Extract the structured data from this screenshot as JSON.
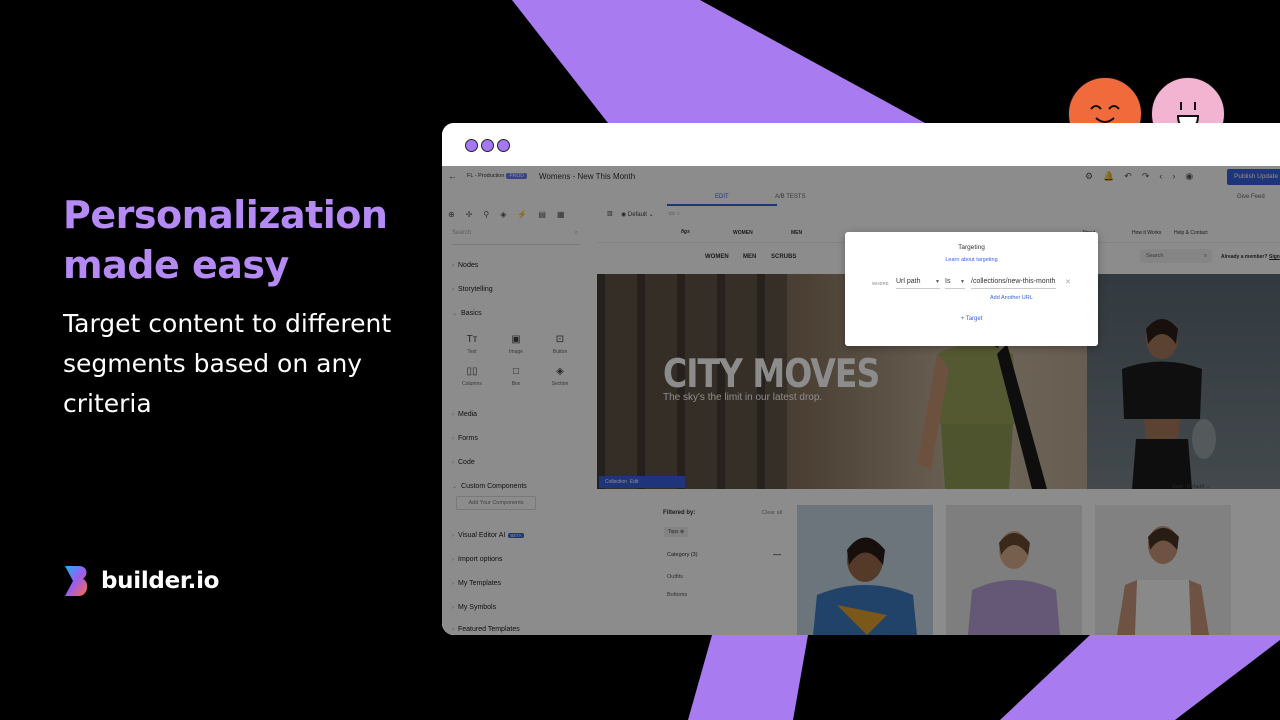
{
  "headline": {
    "title": "Personalization made easy",
    "subtitle": "Target content to different segments based on any criteria"
  },
  "brand": {
    "name": "builder.io"
  },
  "colors": {
    "accent": "#b58af5",
    "primary_blue": "#3a62e0",
    "face_orange": "#f06a3b",
    "face_pink": "#f3b4d2"
  },
  "editor": {
    "environment": "FL - Production",
    "env_badge": "PROD",
    "page_name": "Womens - New This Month",
    "publish_label": "Publish Update",
    "tabs": {
      "edit": "EDIT",
      "ab": "A/B TESTS"
    },
    "give_feedback": "Give Feed",
    "device": "Default",
    "search_placeholder": "Search",
    "sidebar": {
      "nodes": "Nodes",
      "storytelling": "Storytelling",
      "basics": "Basics",
      "blocks": [
        "Text",
        "Image",
        "Button",
        "Columns",
        "Box",
        "Section"
      ],
      "media": "Media",
      "forms": "Forms",
      "code": "Code",
      "custom_components": "Custom Components",
      "add_components": "Add Your Components",
      "visual_editor_ai": "Visual Editor AI",
      "beta": "BETA",
      "import_options": "Import options",
      "my_templates": "My Templates",
      "my_symbols": "My Symbols",
      "featured_templates": "Featured Templates"
    }
  },
  "site": {
    "logo": "figs",
    "top_nav": [
      "WOMEN",
      "MEN"
    ],
    "top_right": [
      "About",
      "How it Works",
      "Help & Contact"
    ],
    "main_nav": [
      "WOMEN",
      "MEN",
      "SCRUBS"
    ],
    "search": "Search",
    "member": "Already a member?",
    "signin": "Sign",
    "hero_title": "CITY MOVES",
    "hero_subtitle": "The sky's the limit in our latest drop.",
    "selection_label": "Collection",
    "selection_edit": "Edit",
    "filtered_by": "Filtered by:",
    "clear_all": "Clear all",
    "tag": "Tops",
    "category": "Category (3)",
    "category_options": [
      "Outfits",
      "Bottoms"
    ],
    "sort_label": "Sort",
    "sort_value": "Default"
  },
  "targeting": {
    "title": "Targeting",
    "learn_link": "Learn about targeting",
    "where": "WHERE",
    "field": "Url path",
    "operator": "Is",
    "value": "/collections/new-this-month",
    "add_url": "Add Another URL",
    "add_target": "+ Target"
  }
}
